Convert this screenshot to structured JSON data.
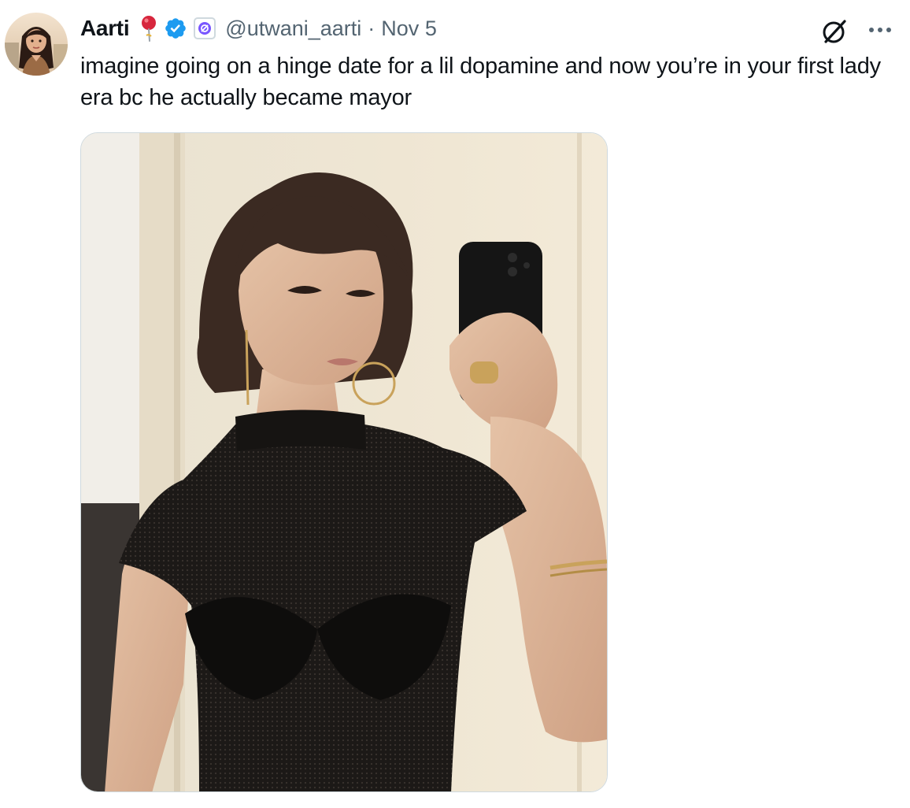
{
  "tweet": {
    "display_name": "Aarti",
    "handle": "@utwani_aarti",
    "separator": "·",
    "date": "Nov 5",
    "text": "imagine going on a hinge date for a lil dopamine and now you’re in your first lady era bc he actually became mayor",
    "icons": {
      "name_emoji": "round-pushpin-emoji",
      "verified": "verified-badge-icon",
      "affiliate": "affiliate-badge-icon",
      "grok": "grok-icon",
      "more": "more-options-icon"
    }
  },
  "colors": {
    "text": "#0f1419",
    "secondary": "#536471",
    "verified_blue": "#1d9bf0",
    "affiliate_purple": "#7856ff",
    "border": "#cfd9de"
  }
}
